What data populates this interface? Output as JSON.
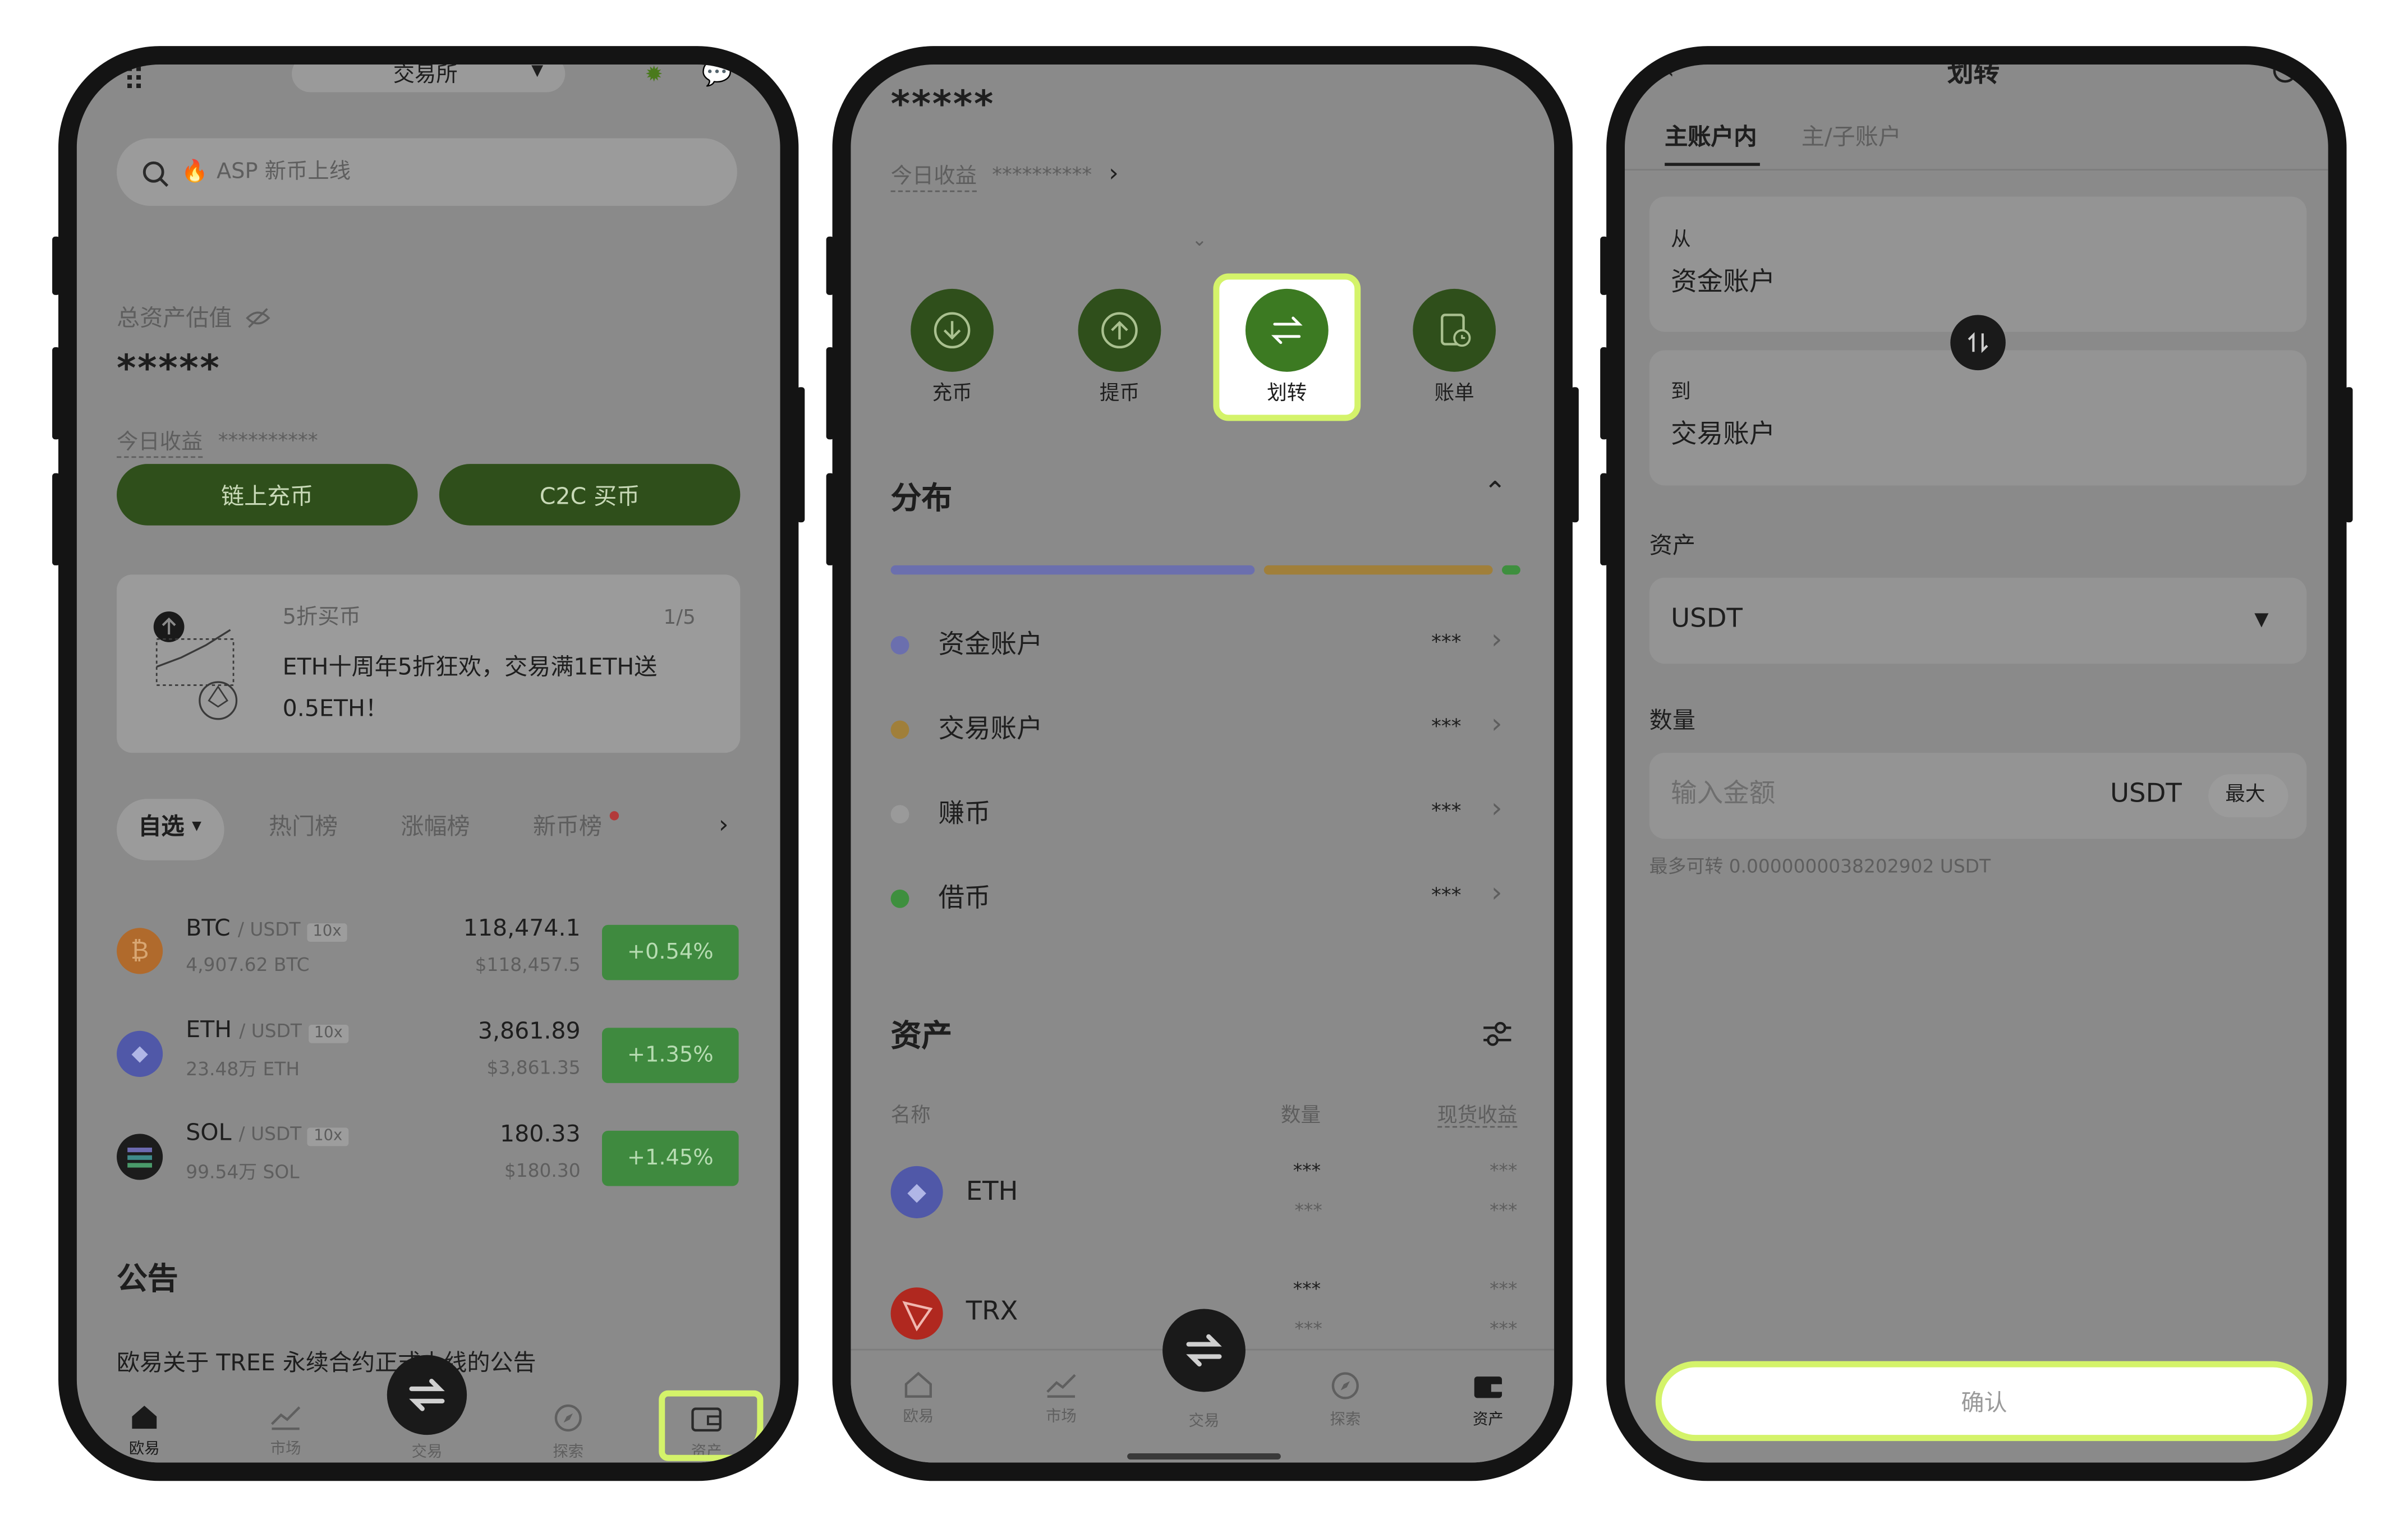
{
  "colors": {
    "accent_green": "#2f4f1b",
    "highlight": "#d4f36a",
    "gain": "#3f8a3f",
    "overlay_gray": "#8a8a8a"
  },
  "s1": {
    "header": {
      "exchange": "交易所"
    },
    "search": {
      "fire": "🔥",
      "text": "ASP 新币上线"
    },
    "total_label": "总资产估值",
    "total_value": "*****",
    "today_label": "今日收益",
    "today_value": "**********",
    "btn_onchain": "链上充币",
    "btn_c2c": "C2C 买币",
    "promo": {
      "title": "5折买币",
      "page": "1/5",
      "line1": "ETH十周年5折狂欢，交易满1ETH送",
      "line2": "0.5ETH！"
    },
    "tabs": [
      "自选",
      "热门榜",
      "涨幅榜",
      "新币榜"
    ],
    "market": [
      {
        "symbol": "BTC",
        "quote": "/ USDT",
        "lev": "10x",
        "vol": "4,907.62 BTC",
        "price": "118,474.1",
        "usd": "$118,457.5",
        "change": "+0.54%"
      },
      {
        "symbol": "ETH",
        "quote": "/ USDT",
        "lev": "10x",
        "vol": "23.48万 ETH",
        "price": "3,861.89",
        "usd": "$3,861.35",
        "change": "+1.35%"
      },
      {
        "symbol": "SOL",
        "quote": "/ USDT",
        "lev": "10x",
        "vol": "99.54万 SOL",
        "price": "180.33",
        "usd": "$180.30",
        "change": "+1.45%"
      }
    ],
    "announce_title": "公告",
    "announce_item": "欧易关于 TREE 永续合约正式上线的公告",
    "nav": [
      "欧易",
      "市场",
      "交易",
      "探索",
      "资产"
    ]
  },
  "s2": {
    "masked": "*****",
    "today_label": "今日收益",
    "today_value": "**********",
    "actions": [
      "充币",
      "提币",
      "划转",
      "账单"
    ],
    "dist_title": "分布",
    "accounts": [
      {
        "name": "资金账户",
        "value": "***",
        "color": "#6b6fae"
      },
      {
        "name": "交易账户",
        "value": "***",
        "color": "#a07f3a"
      },
      {
        "name": "赚币",
        "value": "***",
        "color": "#9a9a9a"
      },
      {
        "name": "借币",
        "value": "***",
        "color": "#3e8f3e"
      }
    ],
    "distribution": [
      {
        "account": "资金账户",
        "share": 0.59,
        "color": "#6b6fae"
      },
      {
        "account": "交易账户",
        "share": 0.37,
        "color": "#a07f3a"
      },
      {
        "account": "借币",
        "share": 0.03,
        "color": "#3e8f3e"
      }
    ],
    "assets_title": "资产",
    "col_name": "名称",
    "col_qty": "数量",
    "col_pnl": "现货收益",
    "assets": [
      {
        "name": "ETH",
        "qty": "***",
        "qty2": "***",
        "pnl": "***",
        "pnl2": "***"
      },
      {
        "name": "TRX",
        "qty": "***",
        "qty2": "***",
        "pnl": "***",
        "pnl2": "***"
      }
    ],
    "nav": [
      "欧易",
      "市场",
      "交易",
      "探索",
      "资产"
    ]
  },
  "s3": {
    "title": "划转",
    "tabs": [
      "主账户内",
      "主/子账户"
    ],
    "from_label": "从",
    "from_value": "资金账户",
    "to_label": "到",
    "to_value": "交易账户",
    "asset_label": "资产",
    "asset_value": "USDT",
    "qty_label": "数量",
    "qty_placeholder": "输入金额",
    "qty_unit": "USDT",
    "max_label": "最大",
    "max_hint": "最多可转 0.0000000038202902 USDT",
    "confirm": "确认"
  }
}
